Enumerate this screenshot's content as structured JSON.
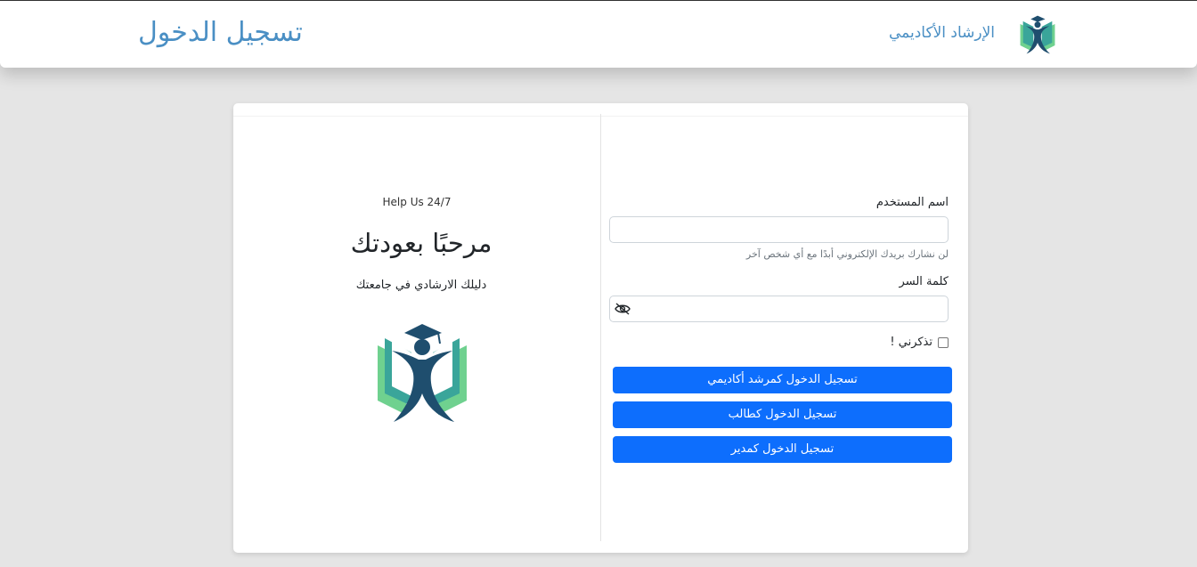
{
  "navbar": {
    "title": "تسجيل الدخول",
    "brand_name": "الإرشاد الأكاديمي"
  },
  "welcome_panel": {
    "help_text": "Help Us 24/7",
    "heading": "مرحبًا بعودتك",
    "tagline": "دليلك الارشادي في جامعتك"
  },
  "login_form": {
    "username_label": "اسم المستخدم",
    "username_value": "",
    "username_hint": "لن نشارك بريدك الإلكتروني أبدًا مع أي شخص آخر",
    "password_label": "كلمة السر",
    "password_value": "",
    "remember_label": "تذكرني !",
    "remember_checked": false,
    "buttons": {
      "advisor": "تسجيل الدخول كمرشد أكاديمي",
      "student": "تسجيل الدخول كطالب",
      "admin": "تسجيل الدخول كمدير"
    }
  },
  "colors": {
    "primary": "#0d6efd",
    "brand": "#4a8fc4",
    "logo_dark": "#1f4e6e",
    "logo_teal": "#3aa59a",
    "logo_green": "#6fd18f"
  },
  "icons": {
    "brand_logo": "academic-advisor-logo",
    "password_toggle": "eye-slash-icon"
  }
}
